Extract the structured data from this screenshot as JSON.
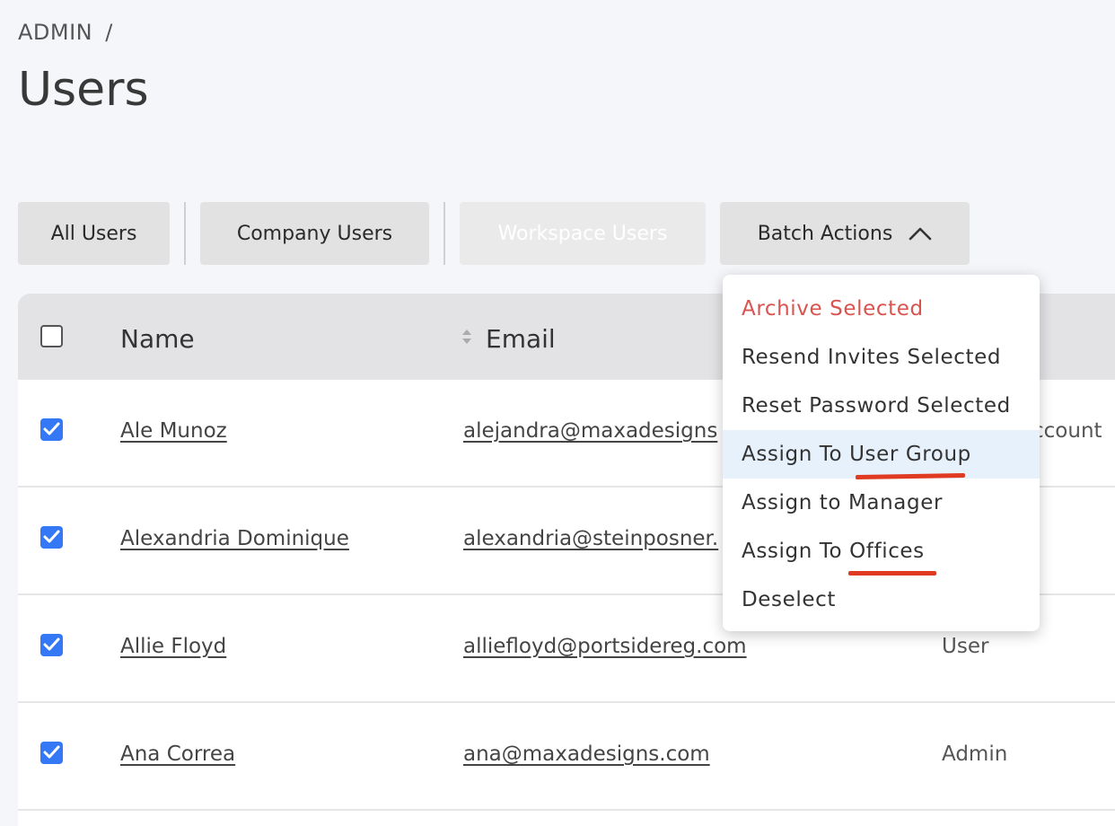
{
  "breadcrumb": {
    "root": "ADMIN",
    "separator": "/"
  },
  "page": {
    "title": "Users"
  },
  "tabs": [
    {
      "label": "All Users"
    },
    {
      "label": "Company Users"
    },
    {
      "label": "Workspace Users",
      "disabled": true
    },
    {
      "label": "Batch Actions",
      "expanded": true
    }
  ],
  "table": {
    "columns": {
      "name": "Name",
      "email": "Email"
    },
    "rows": [
      {
        "name": "Ale Munoz",
        "email": "alejandra@maxadesigns",
        "role": "ccount",
        "checked": true
      },
      {
        "name": "Alexandria Dominique",
        "email": "alexandria@steinposner.",
        "role": "",
        "checked": true
      },
      {
        "name": "Allie Floyd",
        "email": "alliefloyd@portsidereg.com",
        "role": "User",
        "checked": true
      },
      {
        "name": "Ana Correa",
        "email": "ana@maxadesigns.com",
        "role": "Admin",
        "checked": true
      }
    ]
  },
  "batch_menu": {
    "items": [
      {
        "label": "Archive Selected",
        "danger": true
      },
      {
        "label": "Resend Invites Selected"
      },
      {
        "label": "Reset Password Selected"
      },
      {
        "label": "Assign To User Group",
        "highlighted": true
      },
      {
        "label": "Assign to Manager"
      },
      {
        "label": "Assign To Offices"
      },
      {
        "label": "Deselect"
      }
    ]
  },
  "colors": {
    "accent": "#3478f6",
    "danger": "#d9534f",
    "annotation": "#e03a22",
    "highlight": "#e6f1fc"
  }
}
